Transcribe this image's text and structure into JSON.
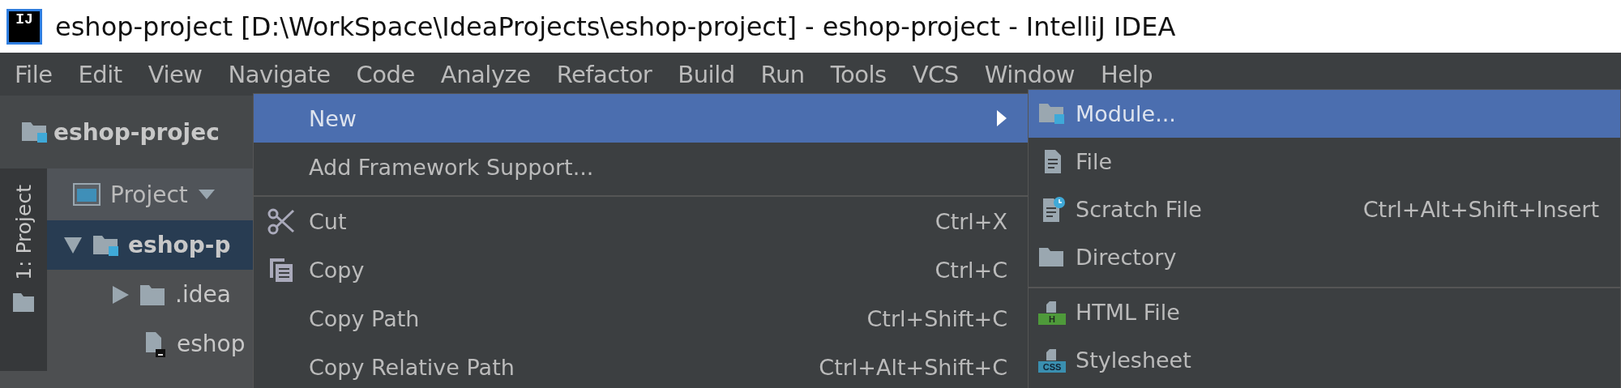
{
  "window": {
    "logo_text": "IJ",
    "title": "eshop-project [D:\\WorkSpace\\IdeaProjects\\eshop-project] - eshop-project - IntelliJ IDEA"
  },
  "menu_bar": [
    {
      "label": "File",
      "selected": false
    },
    {
      "label": "Edit",
      "selected": false
    },
    {
      "label": "View",
      "selected": false
    },
    {
      "label": "Navigate",
      "selected": false
    },
    {
      "label": "Code",
      "selected": false
    },
    {
      "label": "Analyze",
      "selected": false
    },
    {
      "label": "Refactor",
      "selected": false
    },
    {
      "label": "Build",
      "selected": false
    },
    {
      "label": "Run",
      "selected": false
    },
    {
      "label": "Tools",
      "selected": false
    },
    {
      "label": "VCS",
      "selected": false
    },
    {
      "label": "Window",
      "selected": false
    },
    {
      "label": "Help",
      "selected": false
    }
  ],
  "navigation_bar": {
    "project": "eshop-projec"
  },
  "tool_stripe": {
    "label": "1: Project"
  },
  "project_pane": {
    "view": "Project",
    "tree": [
      {
        "label": "eshop-p",
        "selected": true,
        "expanded": true,
        "kind": "module",
        "children": [
          {
            "label": ".idea",
            "selected": false,
            "expanded": false,
            "kind": "folder"
          },
          {
            "label": "eshop",
            "selected": false,
            "kind": "file"
          }
        ]
      }
    ]
  },
  "context_menu": {
    "items": [
      {
        "label": "New",
        "selected": true,
        "submenu": true,
        "separator_after": false
      },
      {
        "label": "Add Framework Support...",
        "selected": false,
        "submenu": false,
        "separator_after": true
      },
      {
        "label": "Cut",
        "shortcut": "Ctrl+X",
        "selected": false,
        "submenu": false,
        "separator_after": false
      },
      {
        "label": "Copy",
        "shortcut": "Ctrl+C",
        "selected": false,
        "submenu": false,
        "separator_after": false
      },
      {
        "label": "Copy Path",
        "shortcut": "Ctrl+Shift+C",
        "selected": false,
        "submenu": false,
        "separator_after": false
      },
      {
        "label": "Copy Relative Path",
        "shortcut": "Ctrl+Alt+Shift+C",
        "selected": false,
        "submenu": false,
        "separator_after": false
      }
    ]
  },
  "new_submenu": {
    "items": [
      {
        "label": "Module...",
        "selected": true,
        "separator_after": false
      },
      {
        "label": "File",
        "selected": false,
        "separator_after": false
      },
      {
        "label": "Scratch File",
        "shortcut": "Ctrl+Alt+Shift+Insert",
        "selected": false,
        "separator_after": false
      },
      {
        "label": "Directory",
        "selected": false,
        "separator_after": true
      },
      {
        "label": "HTML File",
        "icon_label": "H",
        "selected": false,
        "separator_after": false
      },
      {
        "label": "Stylesheet",
        "icon_label": "CSS",
        "selected": false,
        "separator_after": false
      }
    ]
  }
}
